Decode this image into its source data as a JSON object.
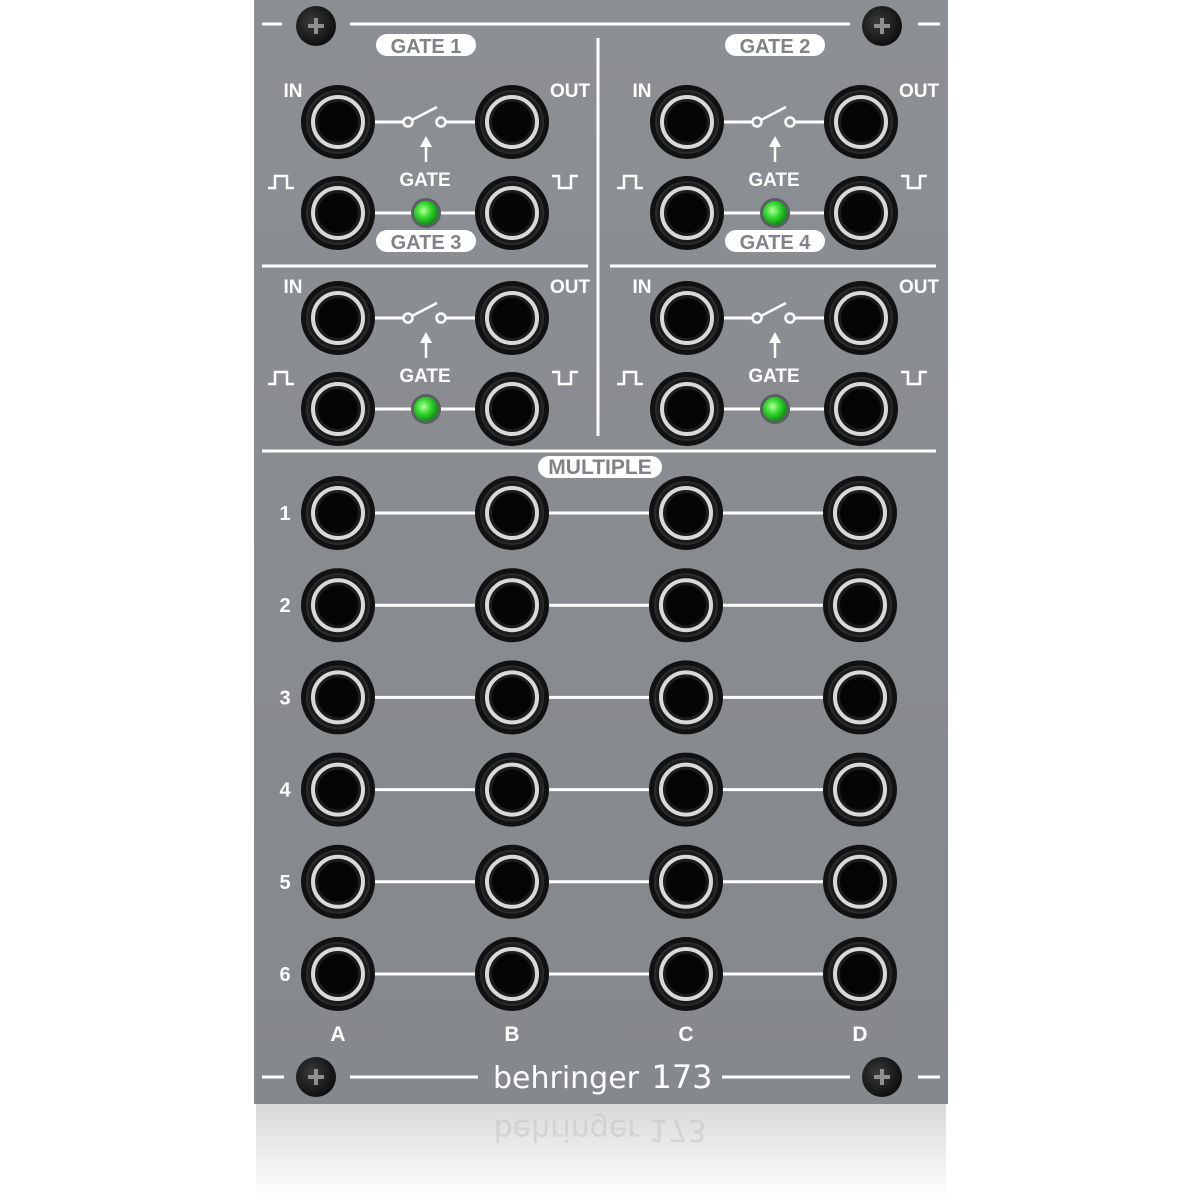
{
  "panel": {
    "brand": "behringer",
    "model": "173",
    "colors": {
      "panel": "#8a8d92",
      "jack": "#111111",
      "led": "#2fd52f",
      "print": "#ffffff"
    }
  },
  "gates": [
    {
      "title": "GATE 1",
      "in_label": "IN",
      "out_label": "OUT",
      "gate_label": "GATE"
    },
    {
      "title": "GATE 2",
      "in_label": "IN",
      "out_label": "OUT",
      "gate_label": "GATE"
    },
    {
      "title": "GATE 3",
      "in_label": "IN",
      "out_label": "OUT",
      "gate_label": "GATE"
    },
    {
      "title": "GATE 4",
      "in_label": "IN",
      "out_label": "OUT",
      "gate_label": "GATE"
    }
  ],
  "multiple": {
    "title": "MULTIPLE",
    "rows": [
      "1",
      "2",
      "3",
      "4",
      "5",
      "6"
    ],
    "columns": [
      "A",
      "B",
      "C",
      "D"
    ]
  },
  "reflection": {
    "text": "behringer 173"
  }
}
